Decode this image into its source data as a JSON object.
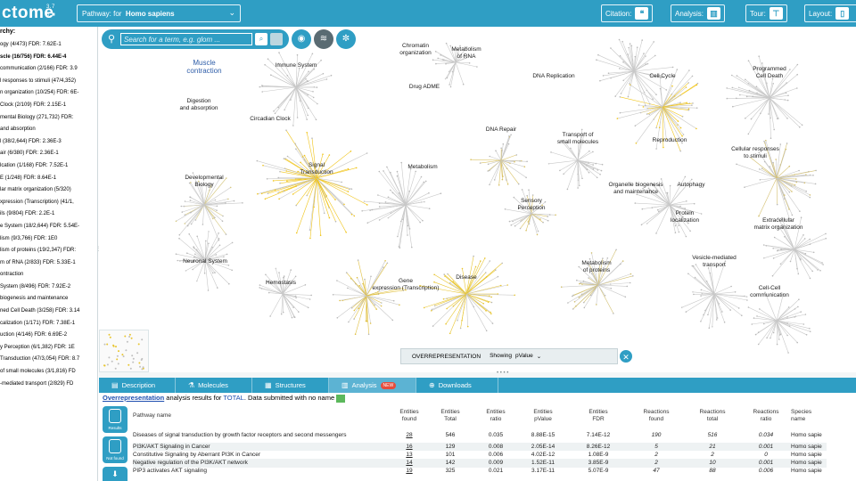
{
  "header": {
    "logo": "ctome",
    "version": "3.7",
    "version2": "5 ■",
    "pathway_label": "Pathway: for",
    "species": "Homo sapiens",
    "citation_label": "Citation:",
    "analysis_label": "Analysis:",
    "tour_label": "Tour:",
    "layout_label": "Layout:"
  },
  "hierarchy": {
    "title": "rchy:",
    "rows": [
      {
        "t": "ogy (4/473) FDR: 7.62E-1",
        "b": false
      },
      {
        "t": "scle (16/756) FDR: 6.44E-4",
        "b": true
      },
      {
        "t": "communication (2/166) FDR: 3.9",
        "b": false
      },
      {
        "t": "l responses to stimuli (47/4,352)",
        "b": false
      },
      {
        "t": "n organization (10/254) FDR: 6E-",
        "b": false
      },
      {
        "t": " Clock (2/109) FDR: 2.15E-1",
        "b": false
      },
      {
        "t": "mental Biology (271,732) FDR:",
        "b": false
      },
      {
        "t": "and absorption",
        "b": false
      },
      {
        "t": "l (38/2,644) FDR: 2.36E-3",
        "b": false
      },
      {
        "t": "air (6/380) FDR: 2.36E-1",
        "b": false
      },
      {
        "t": "lcation (1/168) FDR: 7.52E-1",
        "b": false
      },
      {
        "t": "E (1/248) FDR: 8.64E-1",
        "b": false
      },
      {
        "t": "lar matrix organization (5/320)",
        "b": false
      },
      {
        "t": "xpression (Transcription) (41/1,",
        "b": false
      },
      {
        "t": "ils (9/804) FDR: 2.2E-1",
        "b": false
      },
      {
        "t": "e System (18/2,644) FDR: 5.54E-",
        "b": false
      },
      {
        "t": "lism (9/3,766) FDR: 1E0",
        "b": false
      },
      {
        "t": "lism of proteins (19/2,347) FDR:",
        "b": false
      },
      {
        "t": "m of RNA (2/833) FDR: 5.33E-1",
        "b": false
      },
      {
        "t": "ontraction",
        "b": false
      },
      {
        "t": "System (8/496) FDR: 7.92E-2",
        "b": false
      },
      {
        "t": " biogenesis and maintenance",
        "b": false
      },
      {
        "t": "ned Cell Death (3/258) FDR: 3.14",
        "b": false
      },
      {
        "t": "calization (1/171) FDR: 7.38E-1",
        "b": false
      },
      {
        "t": "uction (4/146) FDR: 6.69E-2",
        "b": false
      },
      {
        "t": "y Perception (6/1,382) FDR: 1E",
        "b": false
      },
      {
        "t": "Transduction (47/3,054) FDR: 8.7",
        "b": false
      },
      {
        "t": " of small molecules (3/1,816) FD",
        "b": false
      },
      {
        "t": "-mediated transport (2/829) FD",
        "b": false
      }
    ]
  },
  "viewer": {
    "search_placeholder": "Search for a term, e.g. glom ...",
    "nodes": [
      {
        "label": "Muscle\ncontraction",
        "hl": true
      },
      {
        "label": "Immune System",
        "hl": false
      },
      {
        "label": "Chromatin\norganization",
        "hl": false
      },
      {
        "label": "Metabolism\nof RNA",
        "hl": false
      },
      {
        "label": "Drug ADME",
        "hl": false
      },
      {
        "label": "DNA Replication",
        "hl": false
      },
      {
        "label": "Cell Cycle",
        "hl": false
      },
      {
        "label": "Programmed\nCell Death",
        "hl": false
      },
      {
        "label": "Digestion\nand absorption",
        "hl": false
      },
      {
        "label": "Circadian Clock",
        "hl": false
      },
      {
        "label": "DNA Repair",
        "hl": false
      },
      {
        "label": "Transport of\nsmall molecules",
        "hl": false
      },
      {
        "label": "Reproduction",
        "hl": false
      },
      {
        "label": "Cellular responses\nto stimuli",
        "hl": false
      },
      {
        "label": "Signal\nTransduction",
        "hl": false
      },
      {
        "label": "Metabolism",
        "hl": false
      },
      {
        "label": "Developmental\nBiology",
        "hl": false
      },
      {
        "label": "Organelle biogenesis\nand maintenance",
        "hl": false
      },
      {
        "label": "Autophagy",
        "hl": false
      },
      {
        "label": "Sensory\nPerception",
        "hl": false
      },
      {
        "label": "Protein\nlocalization",
        "hl": false
      },
      {
        "label": "Extracellular\nmatrix organization",
        "hl": false
      },
      {
        "label": "Neuronal System",
        "hl": false
      },
      {
        "label": "Vesicle-mediated\ntransport",
        "hl": false
      },
      {
        "label": "Metabolism\nof proteins",
        "hl": false
      },
      {
        "label": "Hemostasis",
        "hl": false
      },
      {
        "label": "Gene\nexpression (Transcription)",
        "hl": false
      },
      {
        "label": "Disease",
        "hl": false
      },
      {
        "label": "Cell-Cell\ncommunication",
        "hl": false
      }
    ],
    "overrep_title": "OVERREPRESENTATION",
    "overrep_showing": "Showing",
    "overrep_value": "pValue"
  },
  "tabs": [
    {
      "label": "Description",
      "icon": "▤"
    },
    {
      "label": "Molecules",
      "icon": "⚗"
    },
    {
      "label": "Structures",
      "icon": "▦"
    },
    {
      "label": "Analysis",
      "icon": "▥",
      "badge": "NEW",
      "active": true
    },
    {
      "label": "Downloads",
      "icon": "⊕"
    }
  ],
  "results": {
    "link": "Overrepresentation",
    "text1": " analysis results for ",
    "total": "TOTAL",
    "text2": ". Data submitted with no name",
    "side_results": "Results",
    "side_not_found": "Not found",
    "columns": [
      "Pathway name",
      "Entities\nfound",
      "Entities\nTotal",
      "Entities\nratio",
      "Entities\npValue",
      "Entities\nFDR",
      "Reactions\nfound",
      "Reactions\ntotal",
      "Reactions\nratio",
      "Species name"
    ],
    "rows": [
      [
        "Diseases of signal transduction by growth factor receptors and second messengers",
        "28",
        "546",
        "0.035",
        "8.88E-15",
        "7.14E-12",
        "190",
        "516",
        "0.034",
        "Homo sapie"
      ],
      [
        "PI3K/AKT Signaling in Cancer",
        "16",
        "129",
        "0.008",
        "2.05E-14",
        "8.26E-12",
        "5",
        "21",
        "0.001",
        "Homo sapie"
      ],
      [
        "Constitutive Signaling by Aberrant PI3K in Cancer",
        "13",
        "101",
        "0.006",
        "4.02E-12",
        "1.08E-9",
        "2",
        "2",
        "0",
        "Homo sapie"
      ],
      [
        "Negative regulation of the PI3K/AKT network",
        "14",
        "142",
        "0.009",
        "1.52E-11",
        "3.85E-9",
        "2",
        "10",
        "0.001",
        "Homo sapie"
      ],
      [
        "PIP3 activates AKT signaling",
        "19",
        "325",
        "0.021",
        "3.17E-11",
        "5.07E-9",
        "47",
        "88",
        "0.006",
        "Homo sapie"
      ]
    ]
  }
}
